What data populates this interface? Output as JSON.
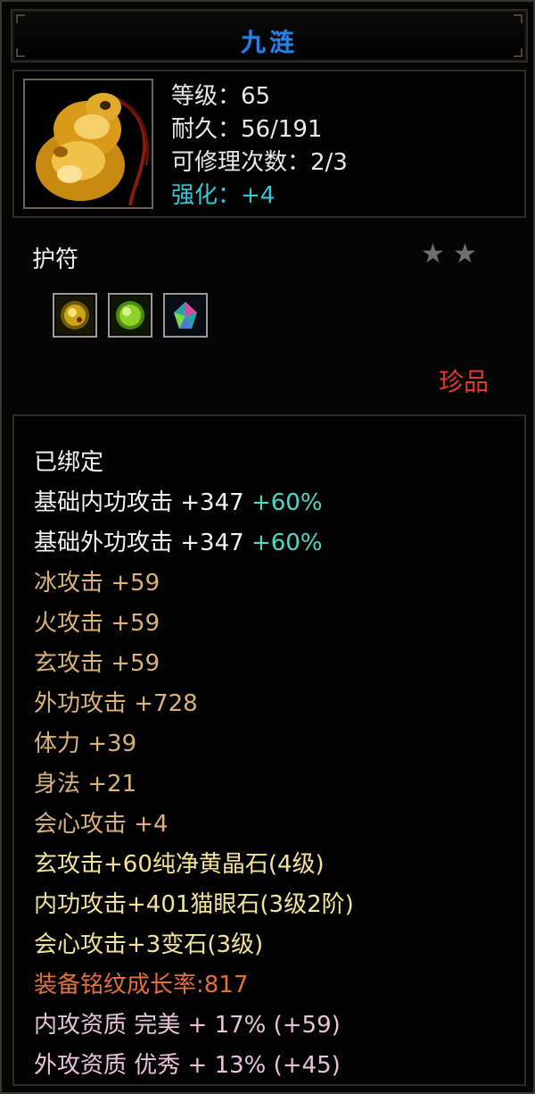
{
  "item": {
    "name": "九涟",
    "level": "等级：65",
    "durability": "耐久：56/191",
    "repair": "可修理次数：2/3",
    "enhance": "强化：+4",
    "type": "护符",
    "stars": [
      "★",
      "★"
    ],
    "rarity": "珍品",
    "gems": [
      {
        "icon": "yellow-crystal-gem-icon"
      },
      {
        "icon": "cats-eye-gem-icon"
      },
      {
        "icon": "change-stone-gem-icon"
      }
    ]
  },
  "attributes": {
    "bound": "已绑定",
    "base_inner": {
      "label": "基础内功攻击 +347",
      "bonus": "+60%"
    },
    "base_outer": {
      "label": "基础外功攻击 +347",
      "bonus": "+60%"
    },
    "ice": "冰攻击 +59",
    "fire": "火攻击 +59",
    "xuan": "玄攻击 +59",
    "outer_attack": "外功攻击 +728",
    "stamina": "体力 +39",
    "agility": "身法 +21",
    "crit": "会心攻击 +4",
    "gem1": "玄攻击+60纯净黄晶石(4级)",
    "gem2": "内功攻击+401猫眼石(3级2阶)",
    "gem3": "会心攻击+3变石(3级)",
    "growth": "装备铭纹成长率:817",
    "inner_quality": "内攻资质 完美 + 17% (+59)",
    "outer_quality": "外攻资质 优秀 + 13% (+45)"
  },
  "colors": {
    "title": "#2b7fe0",
    "enhance": "#35c8d8",
    "rarity": "#e23a2a",
    "bonus": "#4fd8c8",
    "attr_tan": "#d8b27a",
    "gem_yellow": "#f3e39a",
    "growth_orange": "#e2703a",
    "quality_pink": "#e7c3d6"
  }
}
